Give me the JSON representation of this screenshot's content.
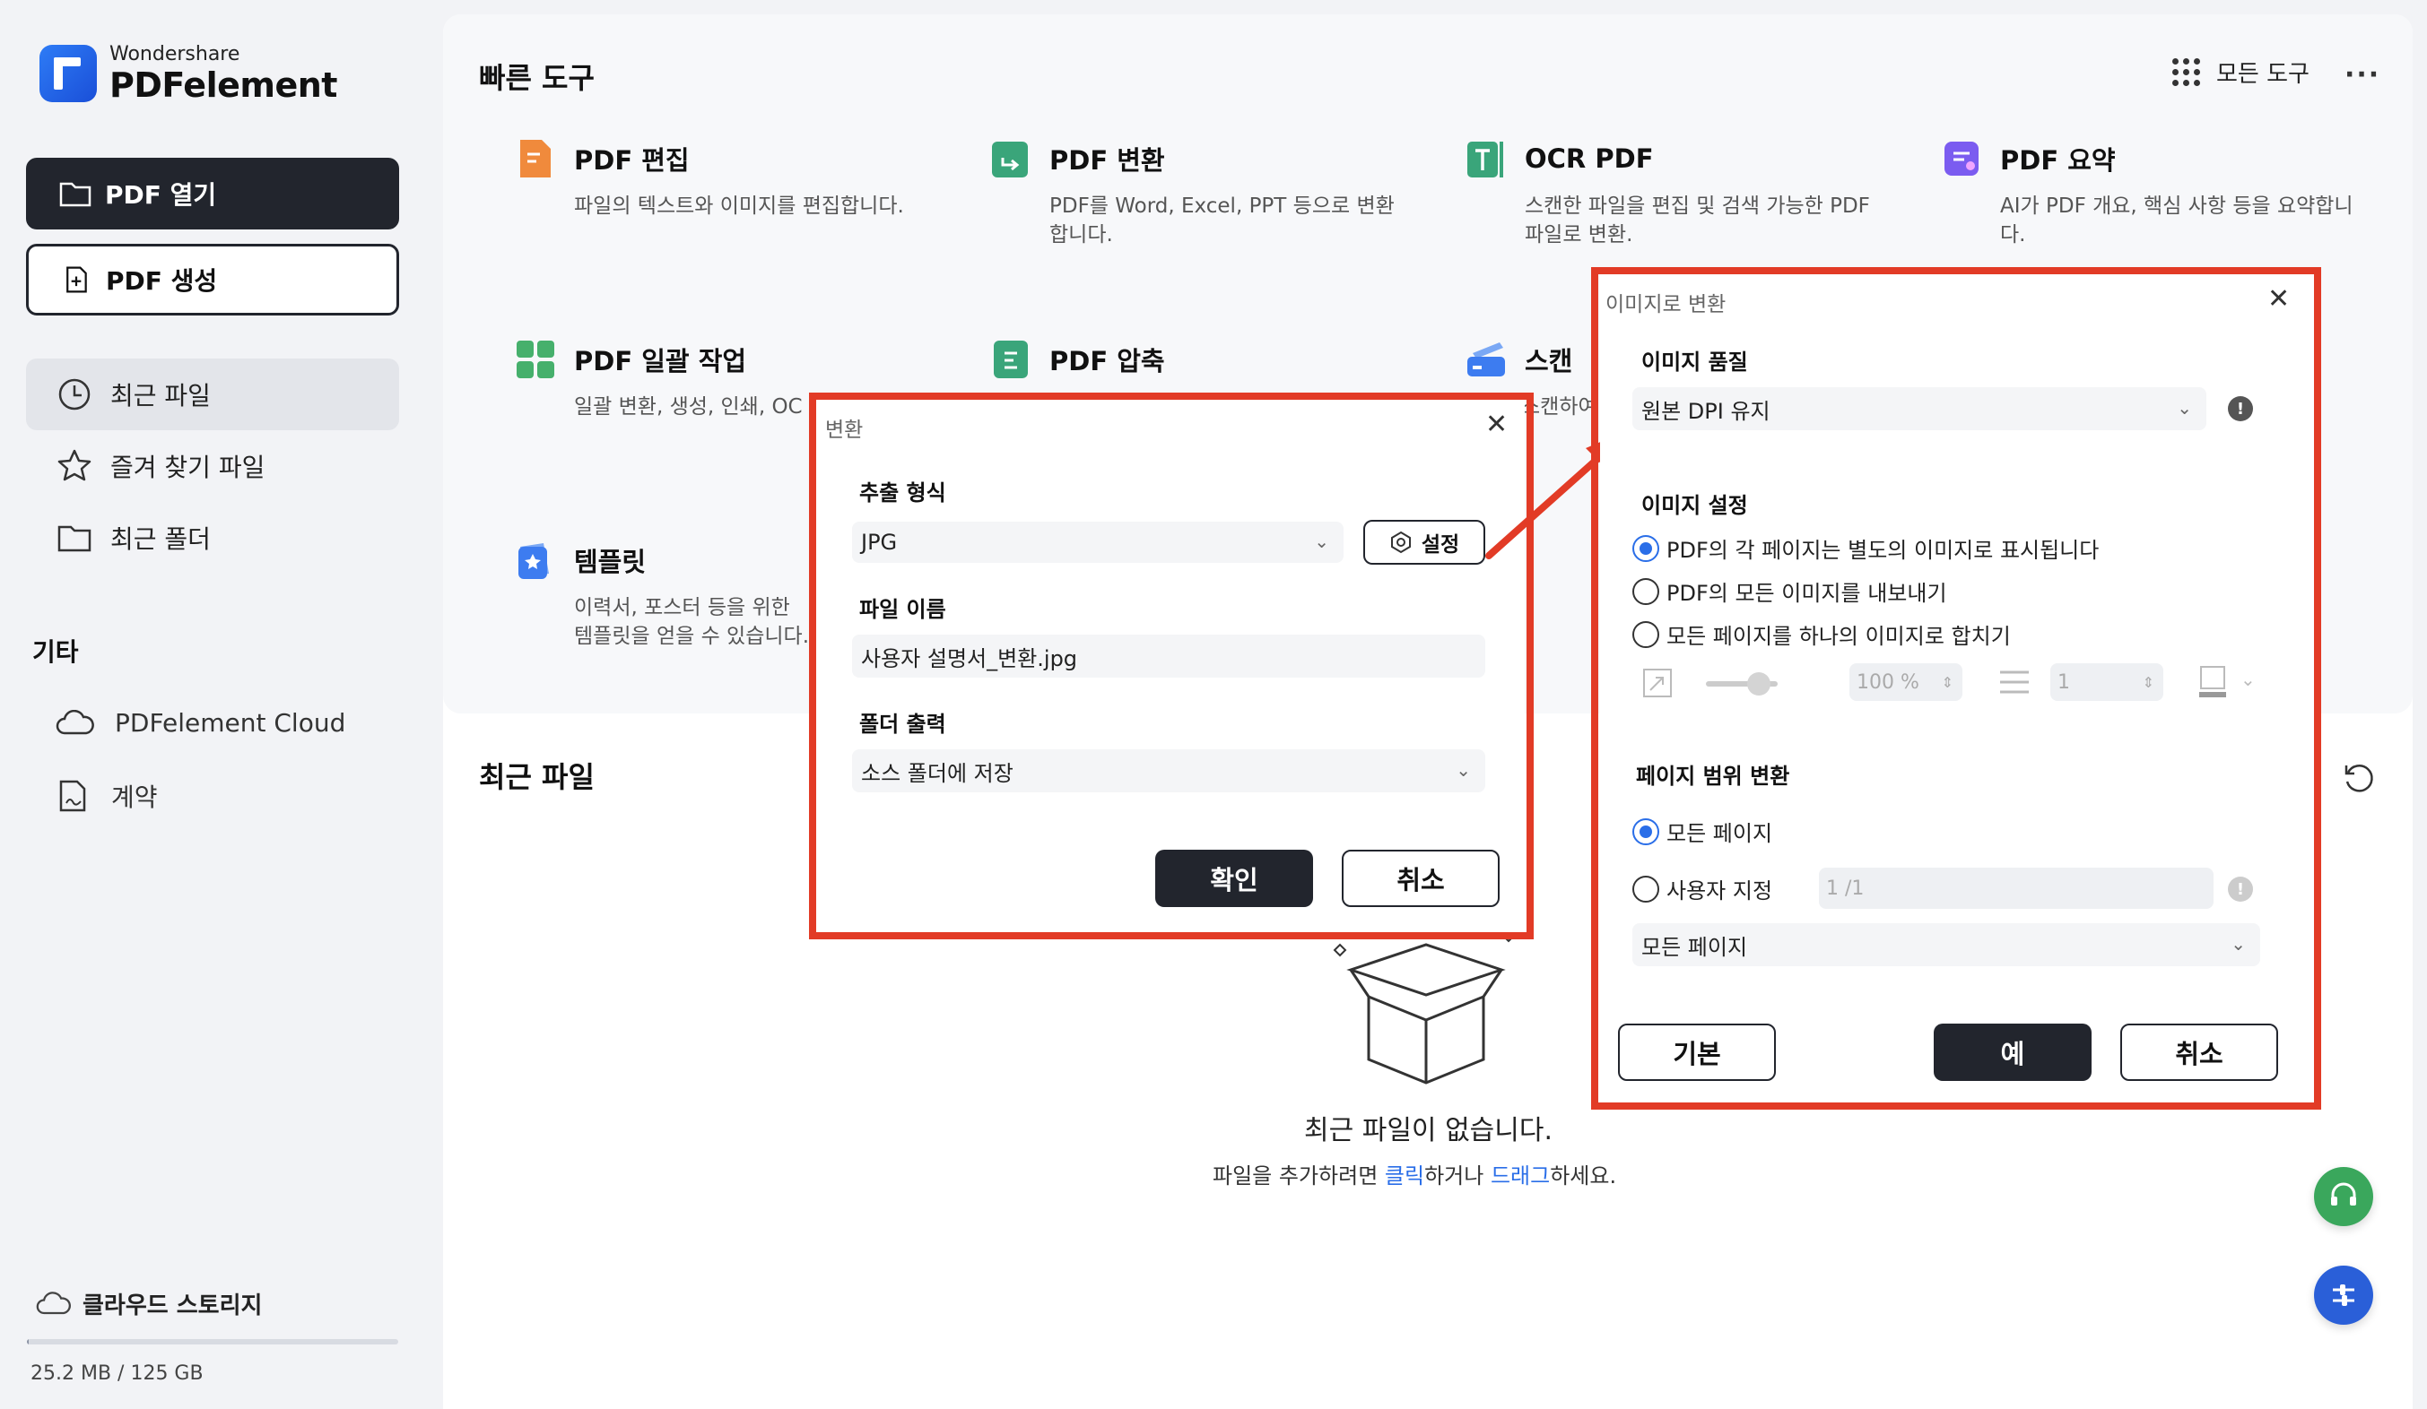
{
  "brand": {
    "small": "Wondershare",
    "big": "PDFelement"
  },
  "sidebar": {
    "open_label": "PDF 열기",
    "create_label": "PDF 생성",
    "nav": [
      {
        "label": "최근 파일",
        "icon": "clock-icon"
      },
      {
        "label": "즐겨 찾기 파일",
        "icon": "star-icon"
      },
      {
        "label": "최근 폴더",
        "icon": "folder-icon"
      }
    ],
    "other_title": "기타",
    "other": [
      {
        "label": "PDFelement Cloud",
        "icon": "cloud-icon"
      },
      {
        "label": "계약",
        "icon": "contract-icon"
      }
    ],
    "cloud_storage_label": "클라우드 스토리지",
    "storage_text": "25.2 MB / 125 GB",
    "storage_fraction": 0.0002
  },
  "quick_tools": {
    "title": "빠른 도구",
    "all_tools_label": "모든 도구",
    "more_label": "···",
    "tools": [
      {
        "name": "PDF 편집",
        "desc": "파일의 텍스트와 이미지를 편집합니다.",
        "color": "#f08a3c"
      },
      {
        "name": "PDF 변환",
        "desc": "PDF를 Word, Excel, PPT 등으로 변환합니다.",
        "color": "#3aa57a"
      },
      {
        "name": "OCR PDF",
        "desc": "스캔한 파일을 편집 및 검색 가능한 PDF 파일로 변환.",
        "color": "#3aa57a"
      },
      {
        "name": "PDF 요약",
        "desc": "AI가 PDF 개요, 핵심 사항 등을 요약합니다.",
        "color": "#7b5cf0"
      },
      {
        "name": "PDF 일괄 작업",
        "desc": "일괄 변환, 생성, 인쇄, OC",
        "color": "#46b06c"
      },
      {
        "name": "PDF 압축",
        "desc": "",
        "color": "#3aa57a"
      },
      {
        "name": "스캔",
        "desc": "스캔하여",
        "color": "#3d7cf0"
      },
      {
        "name": "템플릿",
        "desc": "이력서, 포스터 등을 위한 템플릿을 얻을 수 있습니다.",
        "color": "#3d7cf0"
      }
    ]
  },
  "recent": {
    "title": "최근 파일",
    "empty_title": "최근 파일이 없습니다.",
    "empty_sub_before": "파일을 추가하려면 ",
    "empty_link1": "클릭",
    "empty_sub_mid": "하거나 ",
    "empty_link2": "드래그",
    "empty_sub_after": "하세요."
  },
  "convert_dialog": {
    "title": "변환",
    "format_label": "추출 형식",
    "format_value": "JPG",
    "settings_label": "설정",
    "filename_label": "파일 이름",
    "filename_value": "사용자 설명서_변환.jpg",
    "folder_label": "폴더 출력",
    "folder_value": "소스 폴더에 저장",
    "ok_label": "확인",
    "cancel_label": "취소"
  },
  "image_dialog": {
    "title": "이미지로 변환",
    "quality_label": "이미지 품질",
    "quality_value": "원본 DPI 유지",
    "settings_label": "이미지 설정",
    "options": [
      {
        "label": "PDF의 각 페이지는 별도의 이미지로 표시됩니다",
        "checked": true
      },
      {
        "label": "PDF의 모든 이미지를 내보내기",
        "checked": false
      },
      {
        "label": "모든 페이지를 하나의 이미지로 합치기",
        "checked": false
      }
    ],
    "zoom_value": "100 %",
    "spacing_value": "1",
    "range_label": "페이지 범위 변환",
    "range_options": [
      {
        "label": "모든 페이지",
        "checked": true
      },
      {
        "label": "사용자 지정",
        "checked": false
      }
    ],
    "custom_range_value": "1 /1",
    "page_select_value": "모든 페이지",
    "default_label": "기본",
    "yes_label": "예",
    "cancel_label": "취소"
  },
  "colors": {
    "accent": "#2a6ee8",
    "highlight": "#e23b26",
    "dark": "#22252d"
  }
}
